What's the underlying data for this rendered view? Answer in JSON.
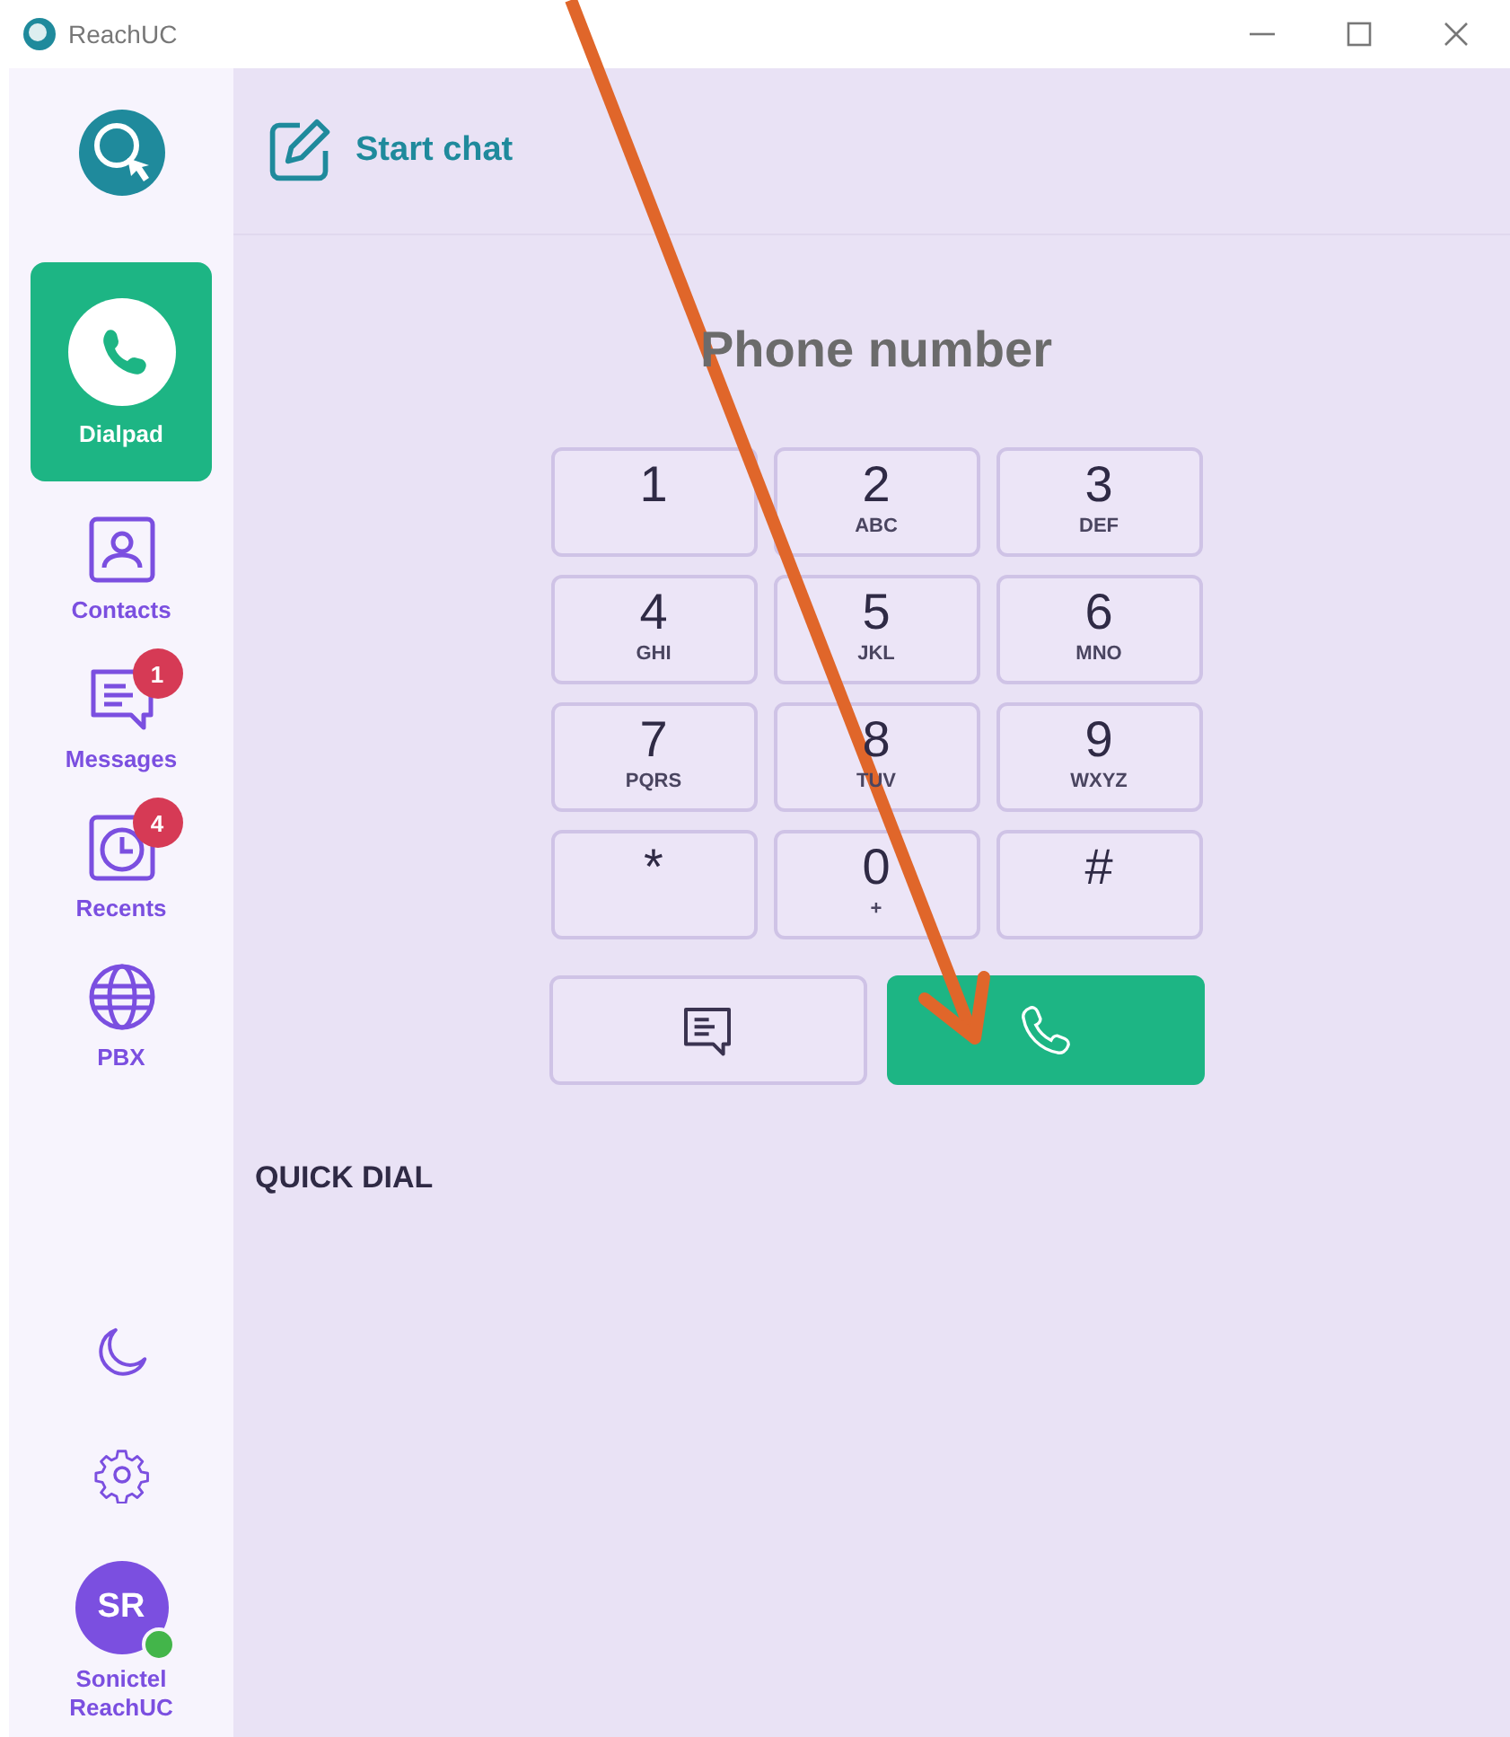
{
  "window": {
    "title": "ReachUC"
  },
  "sidebar": {
    "items": [
      {
        "label": "Dialpad",
        "selected": true
      },
      {
        "label": "Contacts",
        "selected": false
      },
      {
        "label": "Messages",
        "selected": false,
        "badge": "1"
      },
      {
        "label": "Recents",
        "selected": false,
        "badge": "4"
      },
      {
        "label": "PBX",
        "selected": false
      }
    ],
    "user": {
      "initials": "SR",
      "name": "Sonictel ReachUC",
      "online": true
    }
  },
  "header": {
    "action": "Start chat"
  },
  "dialpad": {
    "title": "Phone number",
    "keys": [
      {
        "digit": "1"
      },
      {
        "digit": "2",
        "letters": "ABC"
      },
      {
        "digit": "3",
        "letters": "DEF"
      },
      {
        "digit": "4",
        "letters": "GHI"
      },
      {
        "digit": "5",
        "letters": "JKL"
      },
      {
        "digit": "6",
        "letters": "MNO"
      },
      {
        "digit": "7",
        "letters": "PQRS"
      },
      {
        "digit": "8",
        "letters": "TUV"
      },
      {
        "digit": "9",
        "letters": "WXYZ"
      },
      {
        "digit": "*"
      },
      {
        "digit": "0",
        "letters": "+"
      },
      {
        "digit": "#"
      }
    ]
  },
  "quick_dial": {
    "title": "QUICK DIAL"
  }
}
